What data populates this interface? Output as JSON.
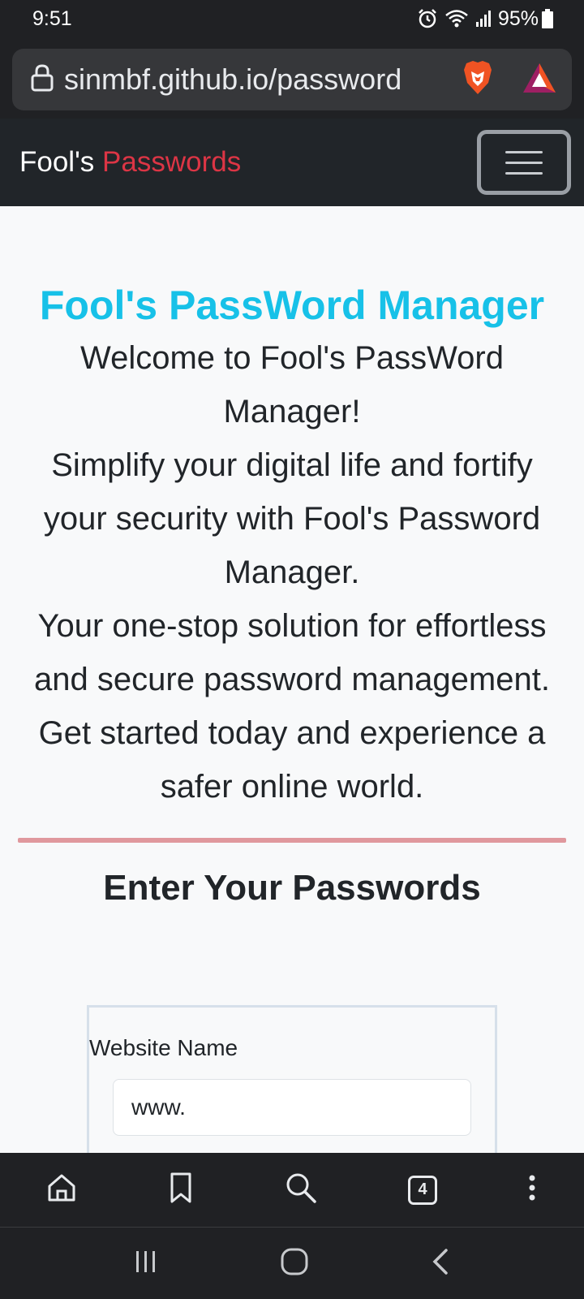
{
  "status": {
    "time": "9:51",
    "battery": "95%",
    "icons": [
      "alarm-icon",
      "wifi-icon",
      "signal-icon",
      "battery-icon"
    ]
  },
  "browser": {
    "url": "sinmbf.github.io/password",
    "icons": [
      "lock-icon",
      "brave-shield-icon",
      "brave-rewards-icon"
    ]
  },
  "navbar": {
    "brand_first": "Fool's",
    "brand_accent": "Passwords",
    "toggler_icon": "hamburger-icon"
  },
  "hero": {
    "title": "Fool's PassWord Manager",
    "lines": [
      "Welcome to Fool's PassWord Manager!",
      "Simplify your digital life and fortify your security with Fool's Password Manager.",
      "Your one-stop solution for effortless and secure password management.",
      "Get started today and experience a safer online world."
    ]
  },
  "form": {
    "section_title": "Enter Your Passwords",
    "website_label": "Website Name",
    "website_value": "www."
  },
  "toolbar": {
    "tab_count": "4",
    "icons": [
      "home-icon",
      "bookmark-icon",
      "search-icon",
      "tabs-icon",
      "more-icon"
    ]
  },
  "system_nav": {
    "icons": [
      "recents-icon",
      "home-circle-icon",
      "back-icon"
    ]
  },
  "colors": {
    "title": "#17c1e8",
    "brand_accent": "#dc3545",
    "divider": "#e0989d",
    "navbar": "#212529"
  }
}
